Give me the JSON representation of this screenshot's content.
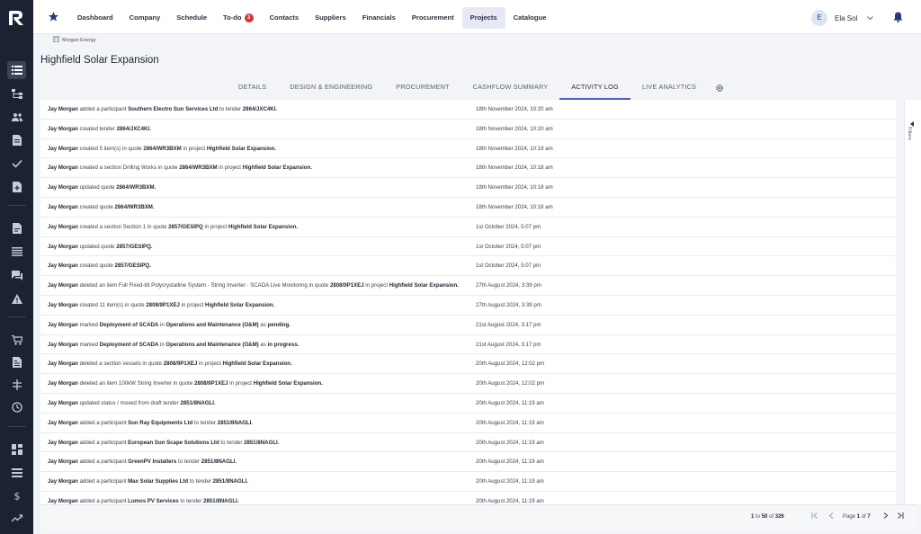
{
  "nav": {
    "items": [
      {
        "label": "Dashboard"
      },
      {
        "label": "Company"
      },
      {
        "label": "Schedule"
      },
      {
        "label": "To-do",
        "badge": "3"
      },
      {
        "label": "Contacts"
      },
      {
        "label": "Suppliers"
      },
      {
        "label": "Financials"
      },
      {
        "label": "Procurement"
      },
      {
        "label": "Projects",
        "active": true
      },
      {
        "label": "Catalogue"
      }
    ]
  },
  "user": {
    "initial": "E",
    "name": "Ela Sol"
  },
  "breadcrumb": "Morgan Energy",
  "page_title": "Highfield Solar Expansion",
  "tabs": [
    {
      "label": "DETAILS"
    },
    {
      "label": "DESIGN & ENGINEERING"
    },
    {
      "label": "PROCUREMENT"
    },
    {
      "label": "CASHFLOW SUMMARY"
    },
    {
      "label": "ACTIVITY LOG",
      "active": true
    },
    {
      "label": "LIVE ANALYTICS"
    }
  ],
  "side_filters_label": "Filters",
  "log": [
    {
      "parts": [
        {
          "t": "Jay Morgan",
          "b": true
        },
        {
          "t": " added a participant "
        },
        {
          "t": "Southern Electro Sun Services Ltd",
          "b": true
        },
        {
          "t": " to tender "
        },
        {
          "t": "2864/JXC4KI.",
          "b": true
        }
      ],
      "time": "18th November 2024, 10:20 am"
    },
    {
      "parts": [
        {
          "t": "Jay Morgan",
          "b": true
        },
        {
          "t": " created tender "
        },
        {
          "t": "2864/JXC4KI.",
          "b": true
        }
      ],
      "time": "18th November 2024, 10:20 am"
    },
    {
      "parts": [
        {
          "t": "Jay Morgan",
          "b": true
        },
        {
          "t": " created 5 item(s) in quote "
        },
        {
          "t": "2864/WR3BXM",
          "b": true
        },
        {
          "t": " in project "
        },
        {
          "t": "Highfield Solar Expansion.",
          "b": true
        }
      ],
      "time": "18th November 2024, 10:19 am"
    },
    {
      "parts": [
        {
          "t": "Jay Morgan",
          "b": true
        },
        {
          "t": " created a section Drilling Works in quote "
        },
        {
          "t": "2864/WR3BXM",
          "b": true
        },
        {
          "t": " in project "
        },
        {
          "t": "Highfield Solar Expansion.",
          "b": true
        }
      ],
      "time": "18th November 2024, 10:18 am"
    },
    {
      "parts": [
        {
          "t": "Jay Morgan",
          "b": true
        },
        {
          "t": " updated quote "
        },
        {
          "t": "2864/WR3BXM.",
          "b": true
        }
      ],
      "time": "18th November 2024, 10:18 am"
    },
    {
      "parts": [
        {
          "t": "Jay Morgan",
          "b": true
        },
        {
          "t": " created quote "
        },
        {
          "t": "2864/WR3BXM.",
          "b": true
        }
      ],
      "time": "18th November 2024, 10:18 am"
    },
    {
      "parts": [
        {
          "t": "Jay Morgan",
          "b": true
        },
        {
          "t": " created a section Section 1 in quote "
        },
        {
          "t": "2857/GESIPQ",
          "b": true
        },
        {
          "t": " in project "
        },
        {
          "t": "Highfield Solar Expansion.",
          "b": true
        }
      ],
      "time": "1st October 2024, 5:07 pm"
    },
    {
      "parts": [
        {
          "t": "Jay Morgan",
          "b": true
        },
        {
          "t": " updated quote "
        },
        {
          "t": "2857/GESIPQ.",
          "b": true
        }
      ],
      "time": "1st October 2024, 5:07 pm"
    },
    {
      "parts": [
        {
          "t": "Jay Morgan",
          "b": true
        },
        {
          "t": " created quote "
        },
        {
          "t": "2857/GESIPQ.",
          "b": true
        }
      ],
      "time": "1st October 2024, 5:07 pm"
    },
    {
      "parts": [
        {
          "t": "Jay Morgan",
          "b": true
        },
        {
          "t": " deleted an item Full Fixed-tilt Polycrystalline System - String Inverter - SCADA Live Monitoring in quote "
        },
        {
          "t": "2808/9P1XEJ",
          "b": true
        },
        {
          "t": " in project "
        },
        {
          "t": "Highfield Solar Expansion.",
          "b": true
        }
      ],
      "time": "27th August 2024, 3:39 pm"
    },
    {
      "parts": [
        {
          "t": "Jay Morgan",
          "b": true
        },
        {
          "t": " created 11 item(s) in quote "
        },
        {
          "t": "2808/9P1XEJ",
          "b": true
        },
        {
          "t": " in project "
        },
        {
          "t": "Highfield Solar Expansion.",
          "b": true
        }
      ],
      "time": "27th August 2024, 3:39 pm"
    },
    {
      "parts": [
        {
          "t": "Jay Morgan",
          "b": true
        },
        {
          "t": " marked "
        },
        {
          "t": "Deployment of SCADA",
          "b": true
        },
        {
          "t": " in "
        },
        {
          "t": "Operations and Maintenance (O&M)",
          "b": true
        },
        {
          "t": " as "
        },
        {
          "t": "pending.",
          "b": true
        }
      ],
      "time": "21st August 2024, 3:17 pm"
    },
    {
      "parts": [
        {
          "t": "Jay Morgan",
          "b": true
        },
        {
          "t": " marked "
        },
        {
          "t": "Deployment of SCADA",
          "b": true
        },
        {
          "t": " in "
        },
        {
          "t": "Operations and Maintenance (O&M)",
          "b": true
        },
        {
          "t": " as "
        },
        {
          "t": "in progress.",
          "b": true
        }
      ],
      "time": "21st August 2024, 3:17 pm"
    },
    {
      "parts": [
        {
          "t": "Jay Morgan",
          "b": true
        },
        {
          "t": " deleted a section vessels in quote "
        },
        {
          "t": "2808/9P1XEJ",
          "b": true
        },
        {
          "t": " in project "
        },
        {
          "t": "Highfield Solar Expansion.",
          "b": true
        }
      ],
      "time": "20th August 2024, 12:02 pm"
    },
    {
      "parts": [
        {
          "t": "Jay Morgan",
          "b": true
        },
        {
          "t": " deleted an item 100kW String Inverter in quote "
        },
        {
          "t": "2808/9P1XEJ",
          "b": true
        },
        {
          "t": " in project "
        },
        {
          "t": "Highfield Solar Expansion.",
          "b": true
        }
      ],
      "time": "20th August 2024, 12:02 pm"
    },
    {
      "parts": [
        {
          "t": "Jay Morgan",
          "b": true
        },
        {
          "t": " updated status / moved from draft tender "
        },
        {
          "t": "2851/8NAGLI.",
          "b": true
        }
      ],
      "time": "20th August 2024, 11:19 am"
    },
    {
      "parts": [
        {
          "t": "Jay Morgan",
          "b": true
        },
        {
          "t": " added a participant "
        },
        {
          "t": "Sun Ray Equipments Ltd",
          "b": true
        },
        {
          "t": " to tender "
        },
        {
          "t": "2851/8NAGLI.",
          "b": true
        }
      ],
      "time": "20th August 2024, 11:19 am"
    },
    {
      "parts": [
        {
          "t": "Jay Morgan",
          "b": true
        },
        {
          "t": " added a participant "
        },
        {
          "t": "European Sun Scape Solutions Ltd",
          "b": true
        },
        {
          "t": " to tender "
        },
        {
          "t": "2851/8NAGLI.",
          "b": true
        }
      ],
      "time": "20th August 2024, 11:19 am"
    },
    {
      "parts": [
        {
          "t": "Jay Morgan",
          "b": true
        },
        {
          "t": " added a participant "
        },
        {
          "t": "GreenPV Installers",
          "b": true
        },
        {
          "t": " to tender "
        },
        {
          "t": "2851/8NAGLI.",
          "b": true
        }
      ],
      "time": "20th August 2024, 11:19 am"
    },
    {
      "parts": [
        {
          "t": "Jay Morgan",
          "b": true
        },
        {
          "t": " added a participant "
        },
        {
          "t": "Max Solar Supplies Ltd",
          "b": true
        },
        {
          "t": " to tender "
        },
        {
          "t": "2851/8NAGLI.",
          "b": true
        }
      ],
      "time": "20th August 2024, 11:19 am"
    },
    {
      "parts": [
        {
          "t": "Jay Morgan",
          "b": true
        },
        {
          "t": " added a participant "
        },
        {
          "t": "Lumos PV Services",
          "b": true
        },
        {
          "t": " to tender "
        },
        {
          "t": "2851/8NAGLI.",
          "b": true
        }
      ],
      "time": "20th August 2024, 11:19 am"
    }
  ],
  "pagination": {
    "range_from": "1",
    "range_to": "50",
    "total": "326",
    "page": "1",
    "pages": "7",
    "to_word": "to",
    "of_word": "of",
    "page_word": "Page"
  },
  "colors": {
    "sidebar": "#1b2232",
    "accent": "#4b5cc4",
    "badge": "#d9342b"
  }
}
